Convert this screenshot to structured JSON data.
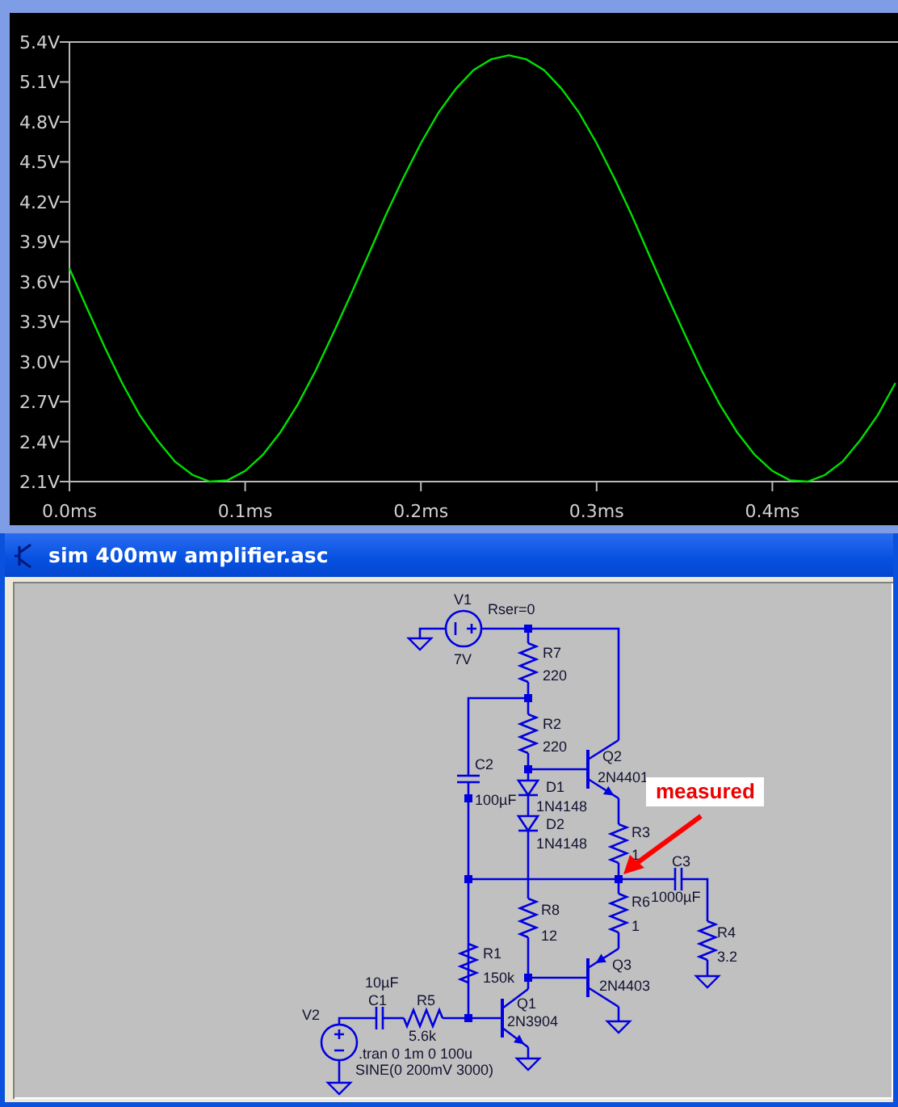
{
  "plot": {
    "chart_data": {
      "type": "line",
      "x": [
        0,
        0.01,
        0.02,
        0.03,
        0.04,
        0.05,
        0.06,
        0.07,
        0.08,
        0.09,
        0.1,
        0.11,
        0.12,
        0.13,
        0.14,
        0.15,
        0.16,
        0.17,
        0.18,
        0.19,
        0.2,
        0.21,
        0.22,
        0.23,
        0.24,
        0.25,
        0.26,
        0.27,
        0.28,
        0.29,
        0.3,
        0.31,
        0.32,
        0.33,
        0.34,
        0.35,
        0.36,
        0.37,
        0.38,
        0.39,
        0.4,
        0.41,
        0.42,
        0.43,
        0.44,
        0.45,
        0.46,
        0.47
      ],
      "series": [
        {
          "color": "#00e000",
          "values": [
            3.7,
            3.4,
            3.11,
            2.84,
            2.6,
            2.41,
            2.25,
            2.15,
            2.1,
            2.11,
            2.18,
            2.3,
            2.47,
            2.68,
            2.93,
            3.21,
            3.5,
            3.8,
            4.1,
            4.38,
            4.64,
            4.87,
            5.05,
            5.19,
            5.27,
            5.3,
            5.27,
            5.19,
            5.05,
            4.87,
            4.64,
            4.38,
            4.1,
            3.8,
            3.5,
            3.21,
            2.93,
            2.68,
            2.47,
            2.3,
            2.18,
            2.11,
            2.1,
            2.15,
            2.25,
            2.41,
            2.6,
            2.84
          ]
        }
      ],
      "xlim": [
        0,
        0.4715
      ],
      "ylim": [
        2.1,
        5.4
      ],
      "xticks": [
        {
          "value": 0,
          "label": "0.0ms"
        },
        {
          "value": 0.1,
          "label": "0.1ms"
        },
        {
          "value": 0.2,
          "label": "0.2ms"
        },
        {
          "value": 0.3,
          "label": "0.3ms"
        },
        {
          "value": 0.4,
          "label": "0.4ms"
        }
      ],
      "yticks": [
        {
          "value": 2.1,
          "label": "2.1V"
        },
        {
          "value": 2.4,
          "label": "2.4V"
        },
        {
          "value": 2.7,
          "label": "2.7V"
        },
        {
          "value": 3.0,
          "label": "3.0V"
        },
        {
          "value": 3.3,
          "label": "3.3V"
        },
        {
          "value": 3.6,
          "label": "3.6V"
        },
        {
          "value": 3.9,
          "label": "3.9V"
        },
        {
          "value": 4.2,
          "label": "4.2V"
        },
        {
          "value": 4.5,
          "label": "4.5V"
        },
        {
          "value": 4.8,
          "label": "4.8V"
        },
        {
          "value": 5.1,
          "label": "5.1V"
        },
        {
          "value": 5.4,
          "label": "5.4V"
        }
      ]
    }
  },
  "schematic_window": {
    "title": "sim 400mw amplifier.asc"
  },
  "schematic": {
    "components": [
      {
        "kind": "source",
        "ref": "V1",
        "value": "7V",
        "spice_line": "Rser=0"
      },
      {
        "kind": "resistor",
        "ref": "R7",
        "value": "220"
      },
      {
        "kind": "resistor",
        "ref": "R2",
        "value": "220"
      },
      {
        "kind": "capacitor",
        "ref": "C2",
        "value": "100µF"
      },
      {
        "kind": "npn",
        "ref": "Q2",
        "value": "2N4401"
      },
      {
        "kind": "diode",
        "ref": "D1",
        "value": "1N4148"
      },
      {
        "kind": "diode",
        "ref": "D2",
        "value": "1N4148"
      },
      {
        "kind": "resistor",
        "ref": "R3",
        "value": "1"
      },
      {
        "kind": "capacitor",
        "ref": "C3",
        "value": "1000µF"
      },
      {
        "kind": "resistor",
        "ref": "R6",
        "value": "1"
      },
      {
        "kind": "resistor",
        "ref": "R8",
        "value": "12"
      },
      {
        "kind": "resistor",
        "ref": "R4",
        "value": "3.2"
      },
      {
        "kind": "resistor",
        "ref": "R1",
        "value": "150k"
      },
      {
        "kind": "pnp",
        "ref": "Q3",
        "value": "2N4403"
      },
      {
        "kind": "capacitor",
        "ref": "C1",
        "value": "10µF"
      },
      {
        "kind": "resistor",
        "ref": "R5",
        "value": "5.6k"
      },
      {
        "kind": "npn",
        "ref": "Q1",
        "value": "2N3904"
      },
      {
        "kind": "source",
        "ref": "V2",
        "value": "SINE(0 200mV 3000)"
      }
    ],
    "directive": ".tran 0 1m 0 100u",
    "annotation": "measured"
  }
}
